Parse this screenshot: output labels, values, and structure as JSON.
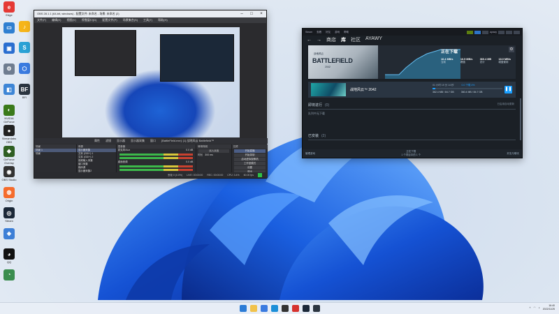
{
  "desktop": {
    "icons": [
      {
        "label": "Edge",
        "icon": "edge-icon",
        "color": "#e53935",
        "glyph": "e"
      },
      {
        "label": "",
        "icon": "this-pc-icon",
        "color": "#2f7fd1",
        "glyph": "▭"
      },
      {
        "label": "",
        "icon": "app-icon",
        "color": "#2a6ed0",
        "glyph": "▣"
      },
      {
        "label": "",
        "icon": "settings-icon",
        "color": "#6f7d90",
        "glyph": "⚙"
      },
      {
        "label": "",
        "icon": "control-panel-icon",
        "color": "#3e86d6",
        "glyph": "◧"
      },
      {
        "label": "NVIDIA GeForce Experience",
        "icon": "nvidia-icon",
        "color": "#3a7a1a",
        "glyph": "◐"
      },
      {
        "label": "Streamlabs OBS",
        "icon": "streamlabs-icon",
        "color": "#222",
        "glyph": "●"
      },
      {
        "label": "GeForce Overlay",
        "icon": "geforce-icon",
        "color": "#2f5f23",
        "glyph": "◆"
      },
      {
        "label": "OBS Studio",
        "icon": "obs-icon",
        "color": "#333",
        "glyph": "◉"
      },
      {
        "label": "Origin",
        "icon": "origin-icon",
        "color": "#f56c2d",
        "glyph": "◍"
      },
      {
        "label": "Steam",
        "icon": "steam-icon",
        "color": "#1b2838",
        "glyph": "◎"
      },
      {
        "label": "",
        "icon": "network-icon",
        "color": "#3d7fd6",
        "glyph": "◈"
      },
      {
        "label": "QQ",
        "icon": "qq-icon",
        "color": "#111",
        "glyph": "◕"
      },
      {
        "label": "",
        "icon": "globe-icon",
        "color": "#3a8d4f",
        "glyph": "◔"
      }
    ],
    "icons_right": [
      {
        "label": "",
        "icon": "qq-music-icon",
        "color": "#f6b519",
        "glyph": "♪"
      },
      {
        "label": "",
        "icon": "bilibili-icon",
        "color": "#2aa2d6",
        "glyph": "S"
      },
      {
        "label": "",
        "icon": "app-icon",
        "color": "#3a7be0",
        "glyph": "⬡"
      },
      {
        "label": "BFI",
        "icon": "bfi-icon",
        "color": "#2b3540",
        "glyph": "BF"
      }
    ]
  },
  "obs": {
    "title": "OBS 28.1.1 (64-bit, windows) - 配置文件: 未命名 - 场景: 未命名 (2)",
    "menu": [
      "文件(F)",
      "编辑(E)",
      "视图(V)",
      "停靠窗口(D)",
      "配置文件(P)",
      "场景集合(S)",
      "工具(T)",
      "帮助(H)"
    ],
    "control_bar": [
      "属性",
      "滤镜",
      "显示器",
      "显示器采集",
      "窗口",
      "[BattleField.exe]: [1] 战地风云 Battlefield™"
    ],
    "scenes_header": "场景",
    "scenes": [
      "场景 1",
      "场景"
    ],
    "sources_header": "来源",
    "sources": [
      "显示器采集",
      "文本 (GDI+) 1",
      "文本 (GDI+) 2",
      "音频输入采集",
      "窗口采集",
      "媒体源",
      "显示器采集2"
    ],
    "mixer_header": "混音器",
    "mixer": [
      {
        "name": "麦克风/Aux",
        "level": "0.0 dB"
      },
      {
        "name": "桌面音频",
        "level": "0.0 dB"
      }
    ],
    "transition_header": "转场特效",
    "transition": {
      "type": "淡入淡出",
      "duration_label": "时长",
      "duration": "300 ms"
    },
    "controls_header": "控件",
    "controls": [
      "开始直播",
      "开始录制",
      "启动虚拟摄像机",
      "工作室模式",
      "设置",
      "退出"
    ],
    "status": [
      "丢帧 0 (0.0%)",
      "LIVE: 00:00:00",
      "REC: 00:00:00",
      "CPU: 3.4%",
      "60.00 fps"
    ]
  },
  "steam": {
    "top_links": [
      "Steam",
      "查看",
      "好友",
      "游戏",
      "帮助"
    ],
    "user": "ayawy",
    "nav": [
      "商店",
      "库",
      "社区",
      "AYAWY"
    ],
    "active_tab": "库",
    "hero_game": {
      "line1": "战地风云",
      "line2": "BATTLEFIELD",
      "line3": "2042"
    },
    "downloading_label": "正在下载",
    "stats": [
      {
        "value": "16.4 MB/s",
        "label": "当前"
      },
      {
        "value": "16.5 MB/s",
        "label": "峰值"
      },
      {
        "value": "360.4 MB",
        "label": "总计"
      },
      {
        "value": "18.0 MB/s",
        "label": "磁盘使用"
      }
    ],
    "current": {
      "name": "战地风云™ 2042",
      "remaining": "01 小时 19 分 14 秒",
      "percent": "0.0 下载 4%",
      "progress": 0.04,
      "downloaded": "362.4 MB / 84.7 GB",
      "disk": "360.4 MB / 84.7 GB"
    },
    "upcoming": {
      "title": "即将进行",
      "count": "(0)",
      "empty": "队列中无下载",
      "right": "已启用自动更新"
    },
    "installed": {
      "title": "已安装",
      "count": "(2)"
    },
    "footer": {
      "left": "管理游戏",
      "mid": "正在下载",
      "mid2": "1 个项目中的 1 个",
      "right": "好友与聊天"
    },
    "colors": {
      "accent": "#1a9fff",
      "bg": "#1b2026"
    }
  },
  "taskbar": {
    "apps": [
      {
        "icon": "start-icon",
        "color": "#2c7cd6"
      },
      {
        "icon": "explorer-icon",
        "color": "#f1c24b"
      },
      {
        "icon": "store-icon",
        "color": "#3a7be0"
      },
      {
        "icon": "edge-icon",
        "color": "#1c8fd8"
      },
      {
        "icon": "obs-taskbar-icon",
        "color": "#333"
      },
      {
        "icon": "netease-icon",
        "color": "#d6322e"
      },
      {
        "icon": "steam-taskbar-icon",
        "color": "#1b2838"
      },
      {
        "icon": "bfi-taskbar-icon",
        "color": "#2b3540"
      }
    ],
    "time": "16:40",
    "date": "2022/11/25"
  }
}
